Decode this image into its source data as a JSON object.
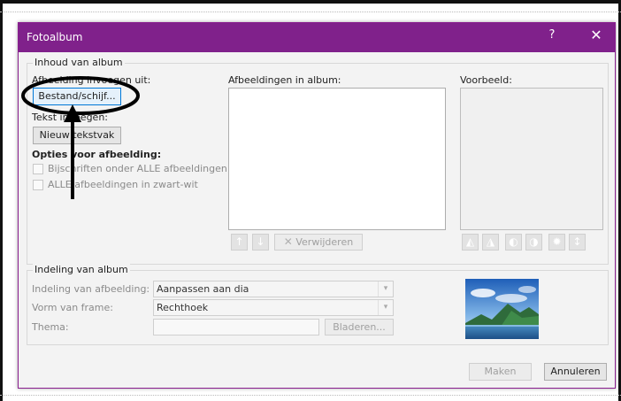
{
  "dialog": {
    "title": "Fotoalbum",
    "help_label": "?",
    "close_label": "✕",
    "accent_color": "#80218b"
  },
  "content": {
    "group_label": "Inhoud van album",
    "insert_from_label": "Afbeelding invoegen uit:",
    "file_button": "Bestand/schijf...",
    "text_insert_label": "Tekst invoegen:",
    "new_textbox_button": "Nieuw tekstvak",
    "picture_options_label": "Opties voor afbeelding:",
    "captions_checkbox": "Bijschriften onder ALLE afbeeldingen",
    "bw_checkbox": "ALLE afbeeldingen in zwart-wit",
    "pictures_label": "Afbeeldingen in album:",
    "preview_label": "Voorbeeld:",
    "remove_button": "Verwijderen"
  },
  "layout": {
    "group_label": "Indeling van album",
    "picture_layout_label": "Indeling van afbeelding:",
    "picture_layout_value": "Aanpassen aan dia",
    "frame_shape_label": "Vorm van frame:",
    "frame_shape_value": "Rechthoek",
    "theme_label": "Thema:",
    "theme_value": "",
    "browse_button": "Bladeren..."
  },
  "footer": {
    "create_button": "Maken",
    "cancel_button": "Annuleren"
  },
  "icons": {
    "move_up": "arrow-up-icon",
    "move_down": "arrow-down-icon",
    "remove": "x-icon",
    "rotate_left": "rotate-left-icon",
    "rotate_right": "rotate-right-icon",
    "contrast_up": "contrast-up-icon",
    "contrast_down": "contrast-down-icon",
    "brightness_up": "brightness-up-icon",
    "brightness_down": "brightness-down-icon"
  }
}
